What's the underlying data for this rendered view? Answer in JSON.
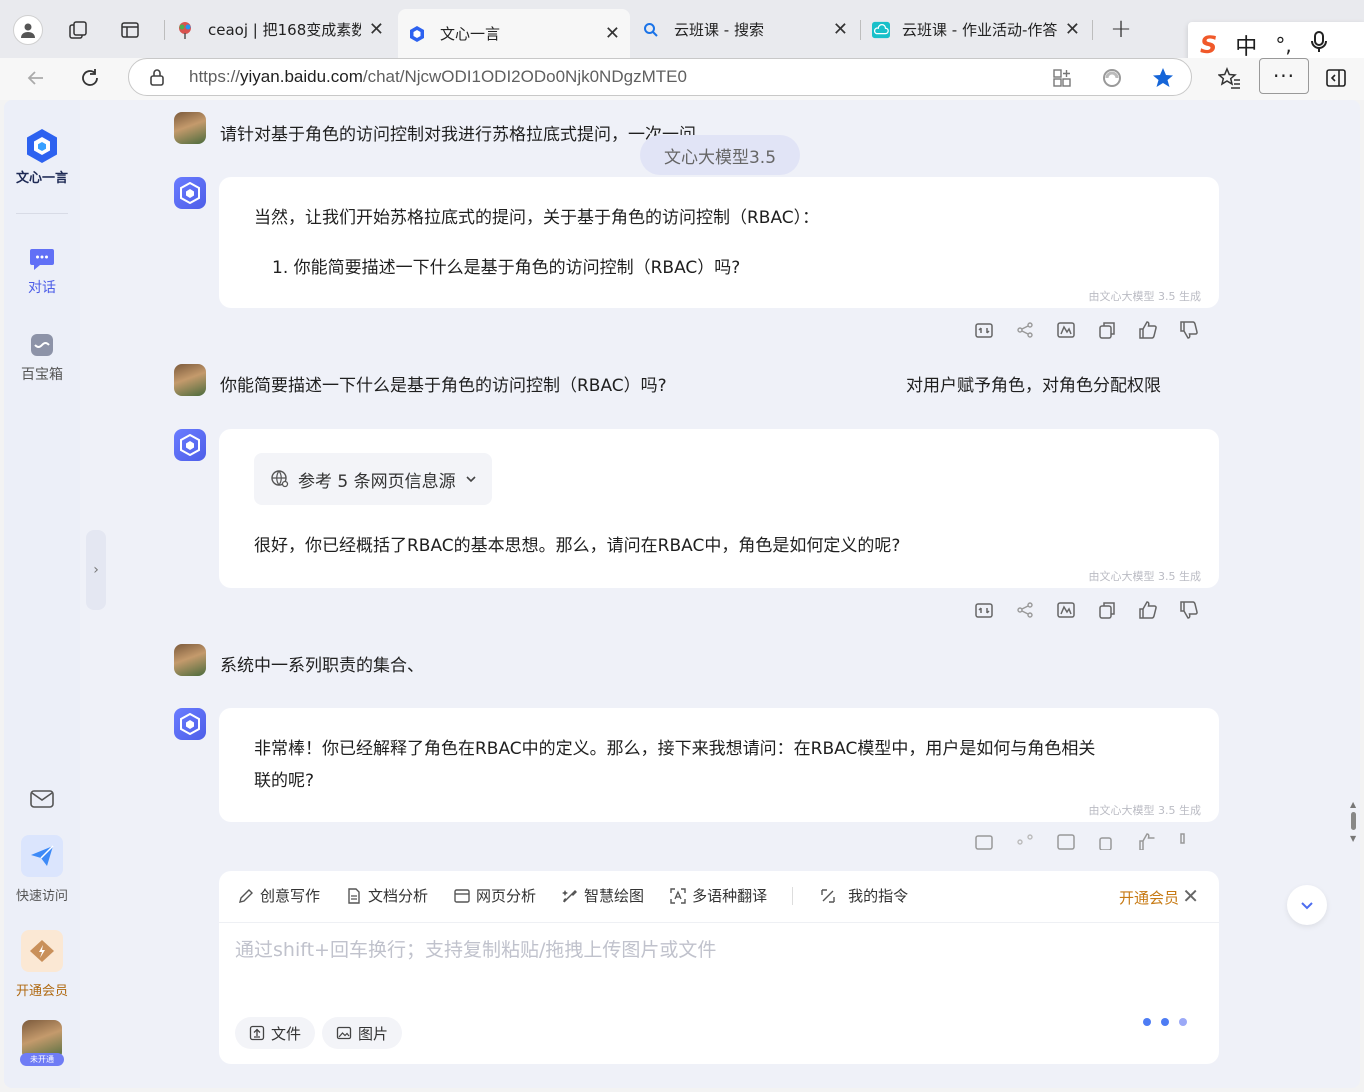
{
  "browser": {
    "tabs": [
      {
        "title": "ceaoj | 把168变成素数"
      },
      {
        "title": "文心一言"
      },
      {
        "title": "云班课 - 搜索"
      },
      {
        "title": "云班课 - 作业活动-作答"
      }
    ],
    "url_prefix": "https://",
    "url_host": "yiyan.baidu.com",
    "url_path": "/chat/NjcwODI1ODI2ODo0Njk0NDgzMTE0",
    "ime": {
      "logo": "S",
      "mode": "中",
      "punct": "°,"
    }
  },
  "sidebar": {
    "logo_text": "文心一言",
    "items": [
      {
        "label": "对话"
      },
      {
        "label": "百宝箱"
      },
      {
        "label": "快速访问"
      },
      {
        "label": "开通会员"
      }
    ],
    "avatar_badge": "未开通"
  },
  "chat": {
    "model_pill": "文心大模型3.5",
    "messages": [
      {
        "role": "user",
        "text": "请针对基于角色的访问控制对我进行苏格拉底式提问，一次一问"
      },
      {
        "role": "bot",
        "lines": [
          "当然，让我们开始苏格拉底式的提问，关于基于角色的访问控制（RBAC）：",
          "1. 你能简要描述一下什么是基于角色的访问控制（RBAC）吗?"
        ],
        "footer": "由文心大模型 3.5 生成"
      },
      {
        "role": "user",
        "text": "你能简要描述一下什么是基于角色的访问控制（RBAC）吗?",
        "answer": "对用户赋予角色，对角色分配权限"
      },
      {
        "role": "bot",
        "reference": "参考 5 条网页信息源",
        "lines": [
          "很好，你已经概括了RBAC的基本思想。那么，请问在RBAC中，角色是如何定义的呢?"
        ],
        "footer": "由文心大模型 3.5 生成"
      },
      {
        "role": "user",
        "text": "系统中一系列职责的集合、"
      },
      {
        "role": "bot",
        "lines": [
          "非常棒！你已经解释了角色在RBAC中的定义。那么，接下来我想请问：在RBAC模型中，用户是如何与角色相关",
          "联的呢?"
        ],
        "footer": "由文心大模型 3.5 生成"
      }
    ]
  },
  "composer": {
    "tools": [
      "创意写作",
      "文档分析",
      "网页分析",
      "智慧绘图",
      "多语种翻译",
      "我的指令"
    ],
    "vip_label": "开通会员",
    "placeholder": "通过shift+回车换行；支持复制粘贴/拖拽上传图片或文件",
    "file_label": "文件",
    "image_label": "图片"
  },
  "colors": {
    "accent": "#4d5ee8",
    "vip": "#c77a14"
  }
}
